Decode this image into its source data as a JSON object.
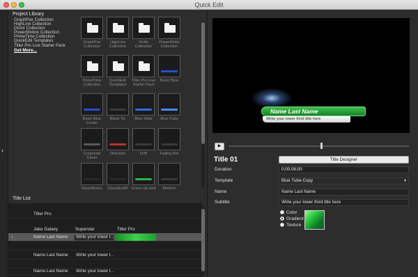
{
  "window": {
    "title": "Quick Edit"
  },
  "left_strip": {
    "expand_glyph": "›"
  },
  "library": {
    "label": "Project Library",
    "collections": [
      "GraphPax Collection",
      "HighLine Collection",
      "OnAir Collection",
      "PowerMotion Collection",
      "PrimeTime Collection",
      "QuickEdit Templates",
      "Titler Pro Live Starter Pack"
    ],
    "more_link": "Get More...",
    "thumbnails": [
      {
        "label": "GraphPax Collection",
        "kind": "folder"
      },
      {
        "label": "HighLine Collection",
        "kind": "folder"
      },
      {
        "label": "OnAir Collection",
        "kind": "folder"
      },
      {
        "label": "PowerMotio Collection",
        "kind": "folder"
      },
      {
        "label": "PrimeTime Collection",
        "kind": "folder"
      },
      {
        "label": "QuickEdit Templates",
        "kind": "folder"
      },
      {
        "label": "Titler Pro Live Starter Pack",
        "kind": "folder"
      },
      {
        "label": "Basic Blue",
        "kind": "template",
        "glow": "#2a4cd6"
      },
      {
        "label": "Basic Blue Center",
        "kind": "template",
        "glow": "#2a4cd6"
      },
      {
        "label": "Black Tie",
        "kind": "template",
        "glow": "#3d3d3d"
      },
      {
        "label": "Blue Slide",
        "kind": "template",
        "glow": "#2f6ee6"
      },
      {
        "label": "Blue Tube",
        "kind": "template",
        "glow": "#4a8cff"
      },
      {
        "label": "Corporate Clean",
        "kind": "template",
        "glow": "#5a5a5a"
      },
      {
        "label": "Direction",
        "kind": "template",
        "glow": "#c03030"
      },
      {
        "label": "Drift",
        "kind": "template",
        "glow": "#3a3a3a"
      },
      {
        "label": "Fading Bar",
        "kind": "template",
        "glow": "#3a3a3a"
      },
      {
        "label": "GlassBoxLe",
        "kind": "template",
        "glow": "#2a2a2a"
      },
      {
        "label": "GlassBoxRi",
        "kind": "template",
        "glow": "#2a2a2a"
      },
      {
        "label": "Green Up and Fade",
        "kind": "template",
        "glow": "#2fb83c"
      },
      {
        "label": "Modern",
        "kind": "template",
        "glow": "#3a3a3a"
      }
    ]
  },
  "title_list": {
    "label": "Title List",
    "group_row": {
      "label": "Titler Pro"
    },
    "header": [
      "Jake Galaxy",
      "Superstar",
      "Titler Pro"
    ],
    "rows": [
      {
        "marker": "›",
        "name": "Name Last Name",
        "subtitle": "Write your lower t...",
        "selected": true,
        "has_green": true
      },
      {
        "name": "",
        "subtitle": "",
        "selected": false
      },
      {
        "name": "Name Last Name",
        "subtitle": "Write your lower t...",
        "selected": false
      },
      {
        "name": "",
        "subtitle": "",
        "selected": false
      },
      {
        "name": "Name Last Name",
        "subtitle": "Write your lower t...",
        "selected": false
      }
    ]
  },
  "preview": {
    "name_text": "Name Last Name",
    "sub_text": "Write your lower third title here"
  },
  "playback": {
    "play_glyph": "▶"
  },
  "properties": {
    "title": "Title 01",
    "designer_button": "Title Designer",
    "duration_label": "Duration",
    "duration_value": "0;00;08;00",
    "template_label": "Template",
    "template_value": "Blue Tube-Copy",
    "dropdown_glyph": "▾",
    "name_label": "Name",
    "name_value": "Name Last Name",
    "subtitle_label": "Subtitle",
    "subtitle_value": "Write your lower third title here",
    "fill_options": [
      {
        "label": "Color",
        "selected": false
      },
      {
        "label": "Gradient",
        "selected": true
      },
      {
        "label": "Texture",
        "selected": false
      }
    ]
  }
}
